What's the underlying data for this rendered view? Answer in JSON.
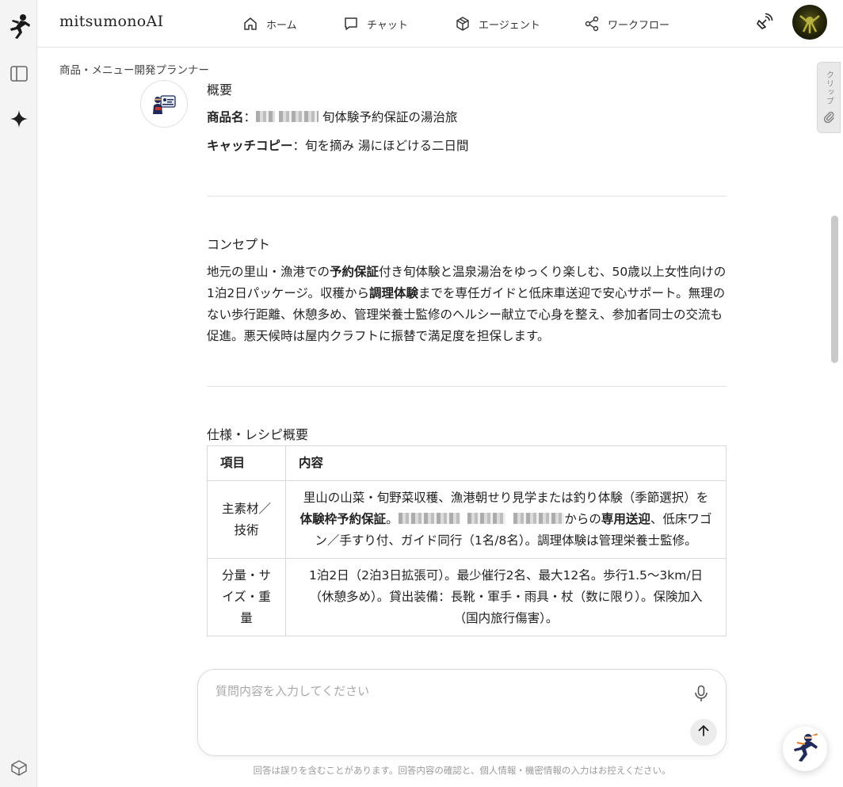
{
  "app": {
    "brand": "mitsumonoAI"
  },
  "nav": {
    "home": "ホーム",
    "chat": "チャット",
    "agent": "エージェント",
    "workflow": "ワークフロー"
  },
  "breadcrumb": "商品・メニュー開発プランナー",
  "clip_tab": {
    "label": "クリップ"
  },
  "overview": {
    "heading": "概要",
    "product_name_label": "商品名",
    "product_name_value": "旬体験予約保証の湯治旅",
    "catchcopy_label": "キャッチコピー",
    "catchcopy_value": "旬を摘み 湯にほどける二日間"
  },
  "concept": {
    "heading": "コンセプト",
    "p_part1": "地元の里山・漁港での",
    "p_bold1": "予約保証",
    "p_part2": "付き旬体験と温泉湯治をゆっくり楽しむ、50歳以上女性向けの1泊2日パッケージ。収穫から",
    "p_bold2": "調理体験",
    "p_part3": "までを専任ガイドと低床車送迎で安心サポート。無理のない歩行距離、休憩多め、管理栄養士監修のヘルシー献立で心身を整え、参加者同士の交流も促進。悪天候時は屋内クラフトに振替で満足度を担保します。"
  },
  "spec": {
    "heading": "仕様・レシピ概要",
    "col_item": "項目",
    "col_content": "内容",
    "rows": [
      {
        "item": "主素材／技術",
        "c_part1": "里山の山菜・旬野菜収穫、漁港朝せり見学または釣り体験（季節選択）を",
        "c_bold1": "体験枠予約保証",
        "c_part2": "。",
        "c_part3": "からの",
        "c_bold2": "専用送迎",
        "c_part4": "、低床ワゴン／手すり付、ガイド同行（1名/8名）。調理体験は管理栄養士監修。"
      },
      {
        "item": "分量・サイズ・重量",
        "content": "1泊2日（2泊3日拡張可）。最少催行2名、最大12名。歩行1.5〜3km/日（休憩多め）。貸出装備：長靴・軍手・雨具・杖（数に限り）。保険加入（国内旅行傷害）。"
      }
    ]
  },
  "composer": {
    "placeholder": "質問内容を入力してください"
  },
  "disclaimer": "回答は誤りを含むことがあります。回答内容の確認と、個人情報・機密情報の入力はお控えください。",
  "icons": {
    "sidebar_logo": "ninja-runner-icon",
    "sidebar_toggle": "sidebar-panel-icon",
    "sparkle": "sparkle-icon",
    "settings": "cube-outline-icon",
    "home": "home-icon",
    "chat": "chat-bubble-icon",
    "agent": "cube-icon",
    "workflow": "share-nodes-icon",
    "broadcast": "satellite-icon",
    "clip": "paperclip-icon",
    "mic": "microphone-icon",
    "send": "arrow-up-icon"
  },
  "colors": {
    "accent": "#1f2a5a",
    "text": "#222222",
    "muted": "#9a9a9a"
  }
}
